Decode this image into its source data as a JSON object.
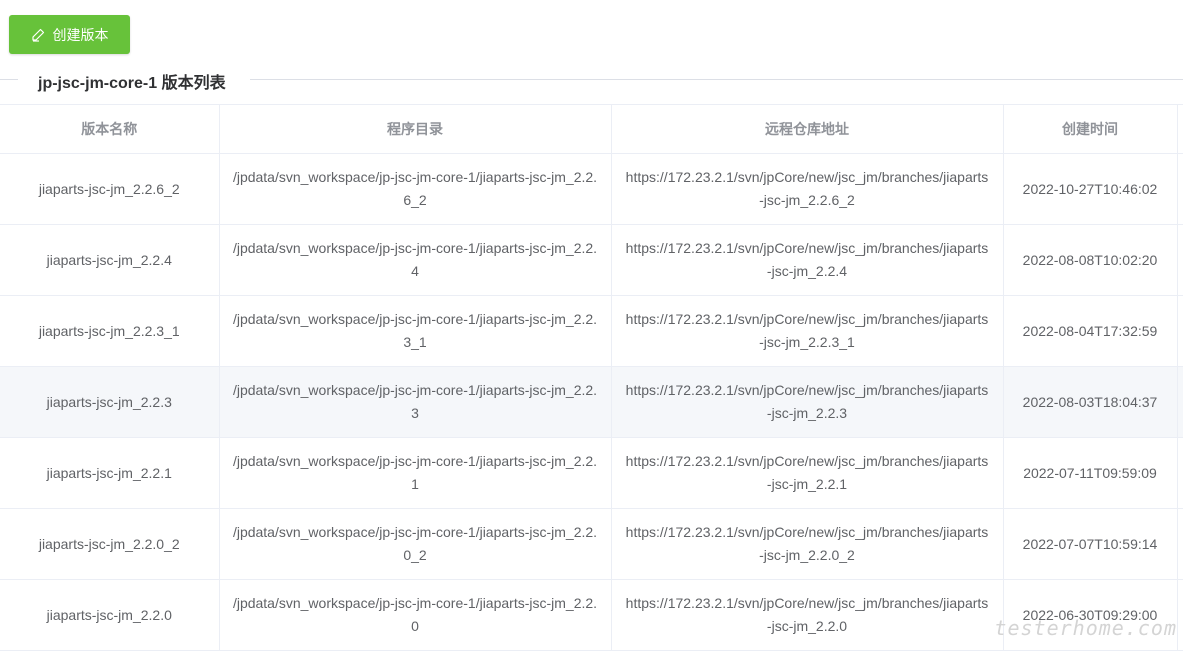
{
  "toolbar": {
    "create_label": "创建版本",
    "create_icon": "edit-icon",
    "accent_color": "#67c23a"
  },
  "section": {
    "title": "jp-jsc-jm-core-1 版本列表"
  },
  "table": {
    "columns": [
      "版本名称",
      "程序目录",
      "远程仓库地址",
      "创建时间"
    ],
    "rows": [
      {
        "name": "jiaparts-jsc-jm_2.2.6_2",
        "dir": "/jpdata/svn_workspace/jp-jsc-jm-core-1/jiaparts-jsc-jm_2.2.6_2",
        "repo": "https://172.23.2.1/svn/jpCore/new/jsc_jm/branches/jiaparts-jsc-jm_2.2.6_2",
        "created": "2022-10-27T10:46:02"
      },
      {
        "name": "jiaparts-jsc-jm_2.2.4",
        "dir": "/jpdata/svn_workspace/jp-jsc-jm-core-1/jiaparts-jsc-jm_2.2.4",
        "repo": "https://172.23.2.1/svn/jpCore/new/jsc_jm/branches/jiaparts-jsc-jm_2.2.4",
        "created": "2022-08-08T10:02:20"
      },
      {
        "name": "jiaparts-jsc-jm_2.2.3_1",
        "dir": "/jpdata/svn_workspace/jp-jsc-jm-core-1/jiaparts-jsc-jm_2.2.3_1",
        "repo": "https://172.23.2.1/svn/jpCore/new/jsc_jm/branches/jiaparts-jsc-jm_2.2.3_1",
        "created": "2022-08-04T17:32:59"
      },
      {
        "name": "jiaparts-jsc-jm_2.2.3",
        "dir": "/jpdata/svn_workspace/jp-jsc-jm-core-1/jiaparts-jsc-jm_2.2.3",
        "repo": "https://172.23.2.1/svn/jpCore/new/jsc_jm/branches/jiaparts-jsc-jm_2.2.3",
        "created": "2022-08-03T18:04:37"
      },
      {
        "name": "jiaparts-jsc-jm_2.2.1",
        "dir": "/jpdata/svn_workspace/jp-jsc-jm-core-1/jiaparts-jsc-jm_2.2.1",
        "repo": "https://172.23.2.1/svn/jpCore/new/jsc_jm/branches/jiaparts-jsc-jm_2.2.1",
        "created": "2022-07-11T09:59:09"
      },
      {
        "name": "jiaparts-jsc-jm_2.2.0_2",
        "dir": "/jpdata/svn_workspace/jp-jsc-jm-core-1/jiaparts-jsc-jm_2.2.0_2",
        "repo": "https://172.23.2.1/svn/jpCore/new/jsc_jm/branches/jiaparts-jsc-jm_2.2.0_2",
        "created": "2022-07-07T10:59:14"
      },
      {
        "name": "jiaparts-jsc-jm_2.2.0",
        "dir": "/jpdata/svn_workspace/jp-jsc-jm-core-1/jiaparts-jsc-jm_2.2.0",
        "repo": "https://172.23.2.1/svn/jpCore/new/jsc_jm/branches/jiaparts-jsc-jm_2.2.0",
        "created": "2022-06-30T09:29:00"
      }
    ]
  },
  "watermark": "testerhome.com"
}
